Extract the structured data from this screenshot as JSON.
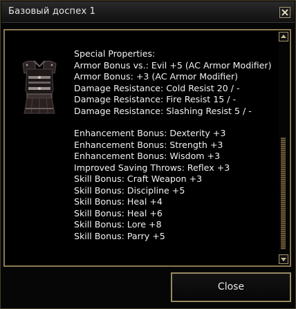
{
  "window": {
    "title": "Базовый доспех 1",
    "close_icon": "close-x-icon"
  },
  "item": {
    "icon": "armor-icon"
  },
  "properties": {
    "heading": "Special Properties:",
    "group1": [
      "Armor Bonus vs.: Evil +5 (AC Armor Modifier)",
      "Armor Bonus: +3 (AC Armor Modifier)",
      "Damage Resistance: Cold Resist 20 / -",
      "Damage Resistance: Fire Resist 15 / -",
      "Damage Resistance: Slashing Resist 5 / -"
    ],
    "group2": [
      "Enhancement Bonus: Dexterity +3",
      "Enhancement Bonus: Strength +3",
      "Enhancement Bonus: Wisdom +3",
      "Improved Saving Throws: Reflex +3",
      "Skill Bonus: Craft Weapon +3",
      "Skill Bonus: Discipline +5",
      "Skill Bonus: Heal +4",
      "Skill Bonus: Heal +6",
      "Skill Bonus: Lore +8",
      "Skill Bonus: Parry +5"
    ]
  },
  "scrollbar": {
    "up_icon": "scroll-up-arrow-icon",
    "down_icon": "scroll-down-arrow-icon"
  },
  "footer": {
    "close_label": "Close"
  },
  "colors": {
    "frame": "#8a7a52",
    "text": "#f2f2f2",
    "background": "#000000"
  }
}
